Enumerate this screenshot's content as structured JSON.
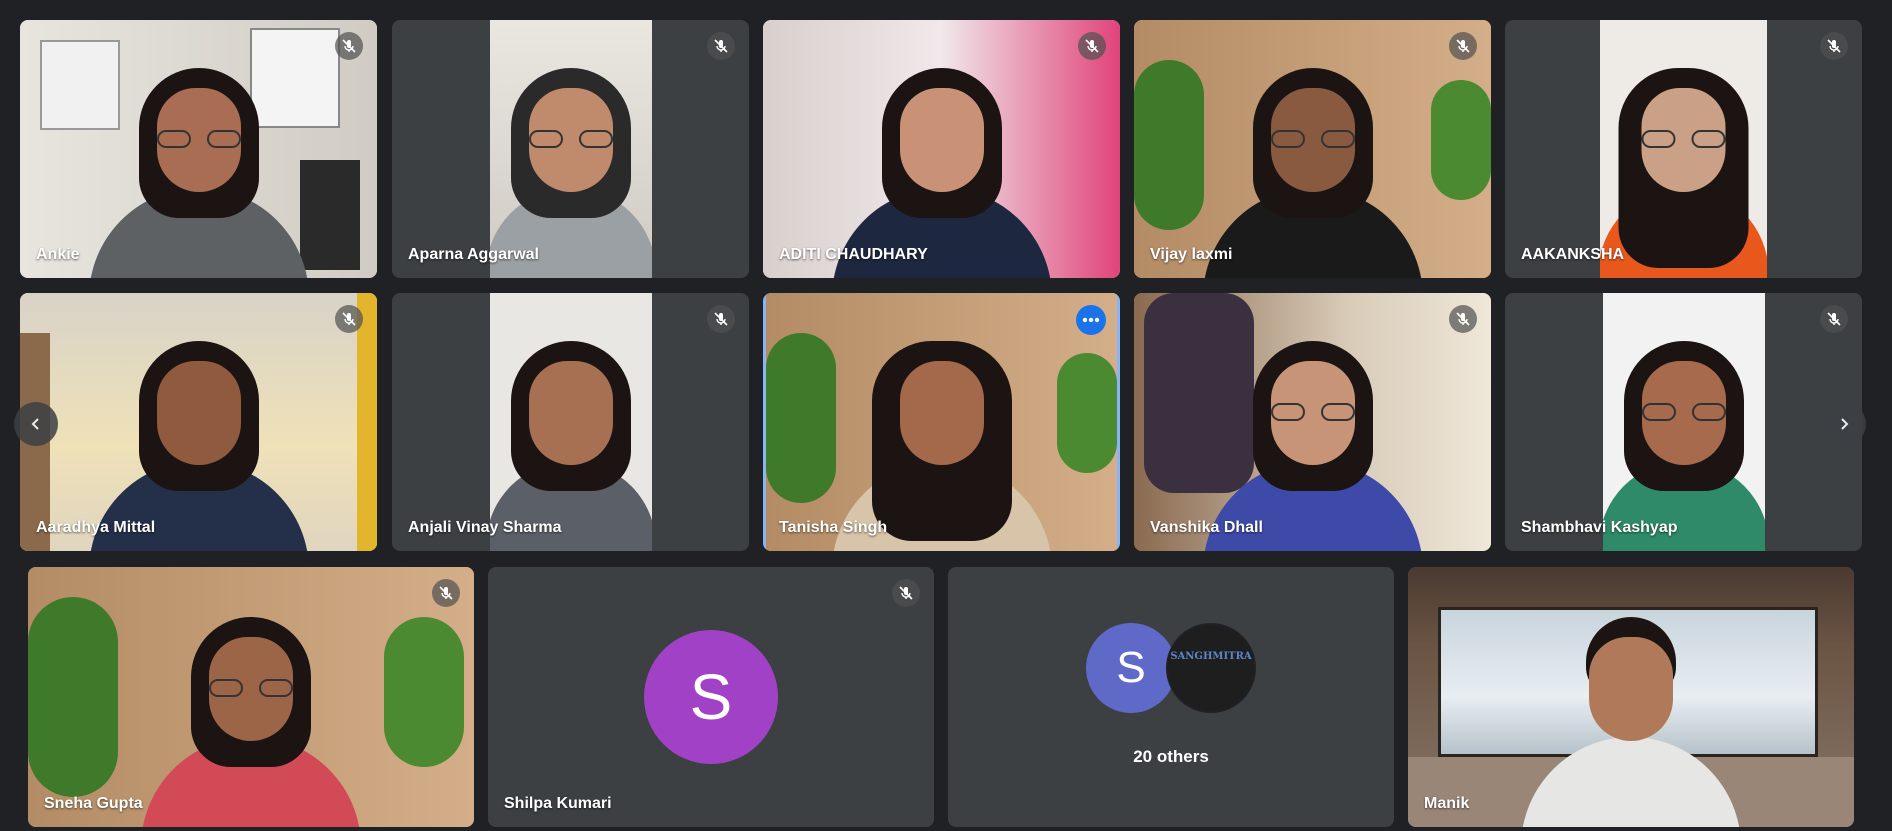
{
  "participants": [
    {
      "name": "Ankie",
      "muted": true
    },
    {
      "name": "Aparna Aggarwal",
      "muted": true
    },
    {
      "name": "ADITI CHAUDHARY",
      "muted": true
    },
    {
      "name": "Vijay laxmi",
      "muted": true
    },
    {
      "name": "AAKANKSHA",
      "muted": true
    },
    {
      "name": "Aaradhya Mittal",
      "muted": true
    },
    {
      "name": "Anjali Vinay Sharma",
      "muted": true
    },
    {
      "name": "Tanisha Singh",
      "muted": false,
      "active": true
    },
    {
      "name": "Vanshika Dhall",
      "muted": true
    },
    {
      "name": "Shambhavi Kashyap",
      "muted": true
    },
    {
      "name": "Sneha Gupta",
      "muted": true
    },
    {
      "name": "Shilpa Kumari",
      "muted": true,
      "avatar_letter": "S",
      "avatar_color": "#a142c6"
    },
    {
      "name": "Manik",
      "muted": false
    }
  ],
  "others": {
    "label": "20 others",
    "avatar_letter": "S",
    "avatar_text": "SANGHMITRA",
    "avatar_color": "#5f6ac8"
  },
  "icons": {
    "mute": "mic-off-icon",
    "more": "more-options-icon",
    "prev": "chevron-left-icon",
    "next": "chevron-right-icon"
  },
  "colors": {
    "background": "#202124",
    "tile": "#3c4043",
    "active_border": "#8ab4f8",
    "accent": "#1a73e8"
  }
}
